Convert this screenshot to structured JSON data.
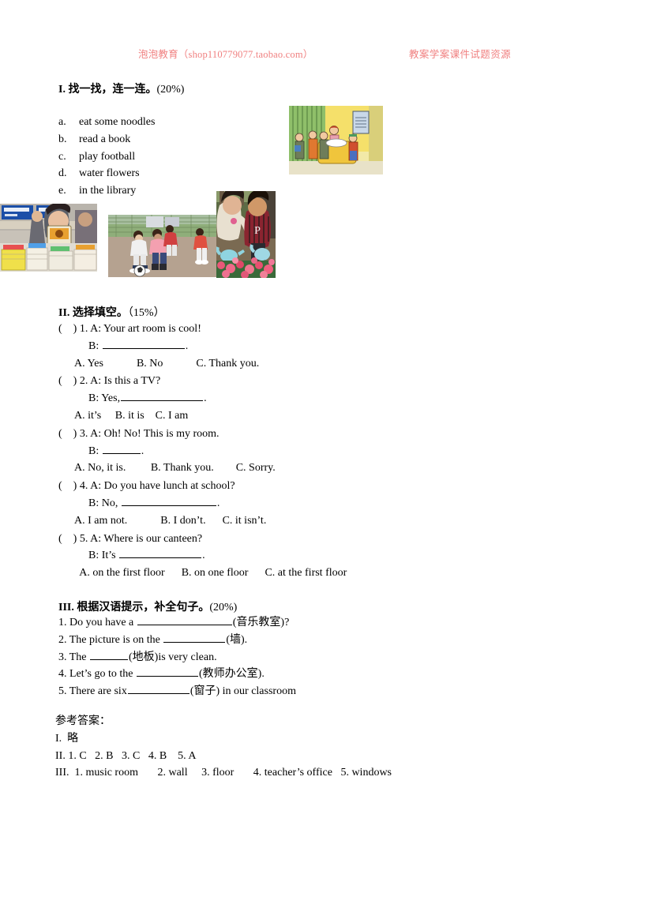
{
  "header": {
    "left": "泡泡教育（shop110779077.taobao.com）",
    "right": "教案学案课件试题资源",
    "color": "#f08080"
  },
  "section_one": {
    "title_number": "I.",
    "title_text": "找一找，连一连。",
    "points": "(20%)",
    "items": [
      {
        "letter": "a.",
        "text": "eat some noodles"
      },
      {
        "letter": "b.",
        "text": "read a book"
      },
      {
        "letter": "c.",
        "text": "play football"
      },
      {
        "letter": "d.",
        "text": "water flowers"
      },
      {
        "letter": "e.",
        "text": "in the library"
      }
    ],
    "photos": [
      {
        "name": "canteen-illustration",
        "caption": "cartoon of students at a school canteen counter"
      },
      {
        "name": "library-photo",
        "caption": "girl reading a book among stacks of books"
      },
      {
        "name": "football-photo",
        "caption": "children playing football on a playground"
      },
      {
        "name": "flowers-photo",
        "caption": "children watering flowers with watering cans"
      }
    ]
  },
  "section_two": {
    "title_number": "II.",
    "title_text": "选择填空。",
    "points": "（15%）",
    "questions": [
      {
        "bracket_open": "(",
        "bracket_close": ")",
        "number": "1.",
        "stem": "A: Your art room is cool!",
        "answer_prefix": "B: ",
        "answer_suffix": ".",
        "options": "A. Yes            B. No            C. Thank you."
      },
      {
        "bracket_open": "(",
        "bracket_close": ")",
        "number": "2.",
        "stem": "A: Is this a TV?",
        "answer_prefix": "B: Yes,",
        "answer_suffix": ".",
        "options": "A. it’s     B. it is    C. I am"
      },
      {
        "bracket_open": "(",
        "bracket_close": ")",
        "number": "3.",
        "stem": "A: Oh! No! This is my room.",
        "answer_prefix": "B: ",
        "answer_suffix": ".",
        "options": "A. No, it is.         B. Thank you.        C. Sorry."
      },
      {
        "bracket_open": "(",
        "bracket_close": ")",
        "number": "4.",
        "stem": "A: Do you have lunch at school?",
        "answer_prefix": "B: No, ",
        "answer_suffix": ".",
        "options": "A. I am not.            B. I don’t.      C. it isn’t."
      },
      {
        "bracket_open": "(",
        "bracket_close": ")",
        "number": "5.",
        "stem": "A: Where is our canteen?",
        "answer_prefix": "B: It’s ",
        "answer_suffix": ".",
        "options": "  A. on the first floor      B. on one floor      C. at the first floor"
      }
    ]
  },
  "section_three": {
    "title_number": "III.",
    "title_text": "根据汉语提示，补全句子。",
    "points": "(20%)",
    "items": [
      {
        "number": "1.",
        "before": "Do you have a ",
        "after": "(音乐教室)?"
      },
      {
        "number": "2.",
        "before": "The picture is on the ",
        "after": "(墙)."
      },
      {
        "number": "3.",
        "before": "The ",
        "after": "(地板)is very clean."
      },
      {
        "number": "4.",
        "before": "Let’s go to the ",
        "after": "(教师办公室)."
      },
      {
        "number": "5.",
        "before": "There are six",
        "after": "(窗子) in our classroom"
      }
    ]
  },
  "answer_key": {
    "heading": "参考答案：",
    "line_one": "I.  略",
    "line_two": "II. 1. C   2. B   3. C   4. B    5. A",
    "line_three": "III.  1. music room       2. wall     3. floor       4. teacher’s office   5. windows"
  }
}
